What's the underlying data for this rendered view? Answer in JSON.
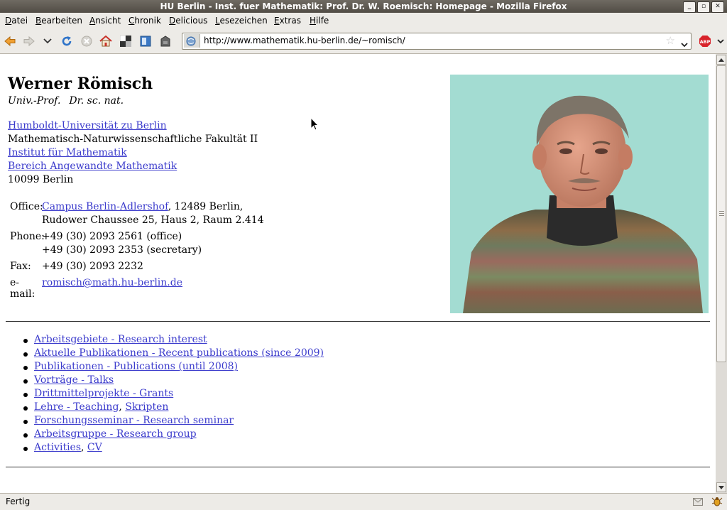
{
  "window": {
    "title": "HU Berlin - Inst. fuer Mathematik: Prof. Dr. W. Roemisch: Homepage - Mozilla Firefox"
  },
  "menu": [
    "Datei",
    "Bearbeiten",
    "Ansicht",
    "Chronik",
    "Delicious",
    "Lesezeichen",
    "Extras",
    "Hilfe"
  ],
  "toolbar": {
    "url": "http://www.mathematik.hu-berlin.de/~romisch/",
    "icons": [
      "back-icon",
      "forward-icon",
      "history-dropdown-icon",
      "reload-icon",
      "stop-icon",
      "home-icon",
      "delicious-icon",
      "bookmark-icon",
      "tag-icon",
      "site-identity-icon",
      "bookmark-star-icon",
      "adblock-icon"
    ],
    "adblock_label": "ABP"
  },
  "page": {
    "name": "Werner Römisch",
    "title_1": "Univ.-Prof.",
    "title_2": "Dr. sc. nat.",
    "affiliation": {
      "university": "Humboldt-Universität zu Berlin",
      "faculty": "Mathematisch-Naturwissenschaftliche Fakultät II",
      "institute": "Institut für Mathematik",
      "department": "Bereich Angewandte Mathematik",
      "city": "10099 Berlin"
    },
    "contact": {
      "office_label": "Office:",
      "office_campus": "Campus Berlin-Adlershof",
      "office_rest": ", 12489 Berlin,",
      "office_line2": "Rudower Chaussee 25, Haus 2, Raum 2.414",
      "phone_label": "Phone:",
      "phone_1": "+49 (30) 2093 2561 (office)",
      "phone_2": "+49 (30) 2093 2353 (secretary)",
      "fax_label": "Fax:",
      "fax": "+49 (30) 2093 2232",
      "email_label": "e-mail:",
      "email": "romisch@math.hu-berlin.de"
    },
    "links": [
      {
        "text": "Arbeitsgebiete - Research interest"
      },
      {
        "text": "Aktuelle Publikationen - Recent publications (since 2009)"
      },
      {
        "text": "Publikationen - Publications (until 2008)"
      },
      {
        "text": "Vorträge - Talks"
      },
      {
        "text": "Drittmittelprojekte - Grants"
      },
      {
        "text": "Lehre - Teaching",
        "sep": ", ",
        "extra": "Skripten"
      },
      {
        "text": "Forschungsseminar - Research seminar"
      },
      {
        "text": "Arbeitsgruppe - Research group"
      },
      {
        "text": "Activities",
        "sep": ", ",
        "extra": "CV"
      }
    ]
  },
  "status": {
    "text": "Fertig"
  },
  "colors": {
    "link": "#3b3bcc",
    "photo_bg": "#a3dcd2",
    "chrome": "#edebe7"
  }
}
